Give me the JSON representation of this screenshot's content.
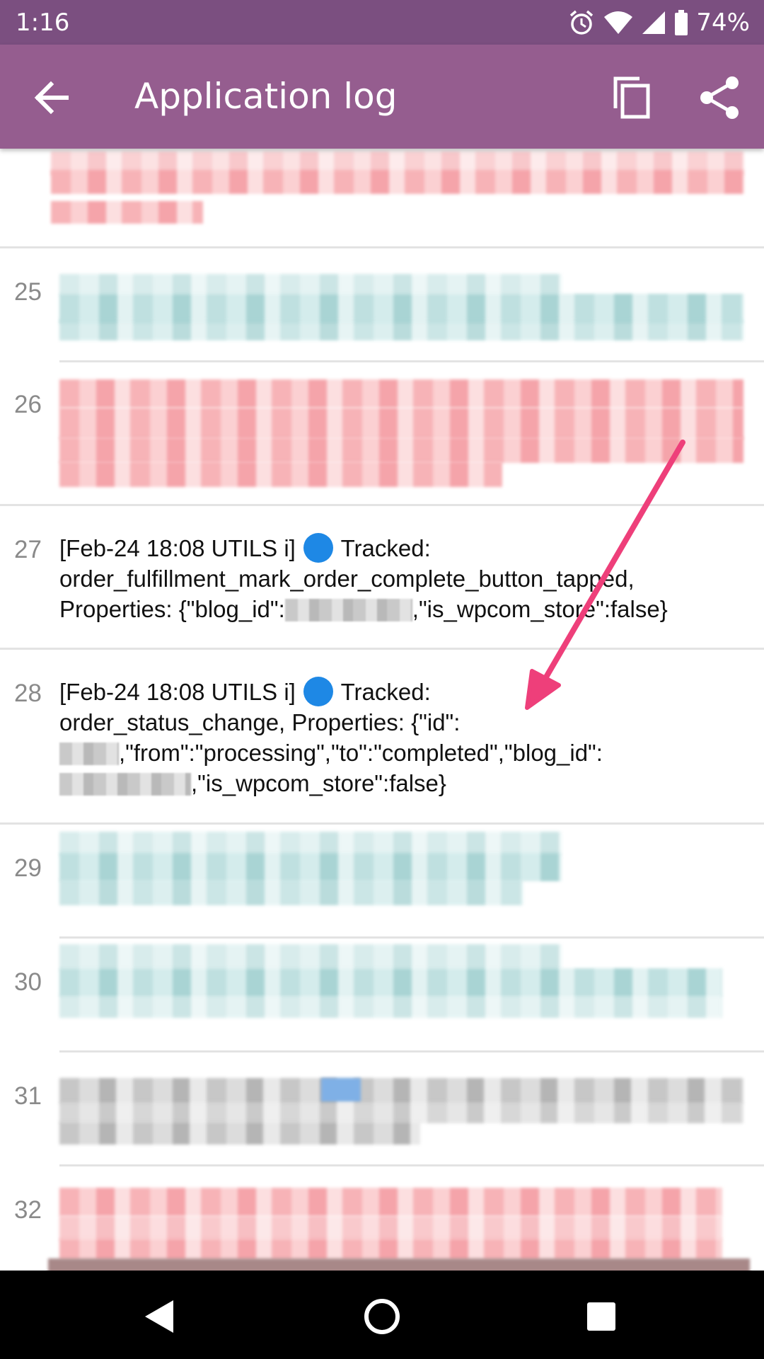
{
  "status_bar": {
    "time": "1:16",
    "battery": "74%",
    "icons": [
      "alarm-icon",
      "wifi-icon",
      "signal-icon",
      "battery-icon"
    ]
  },
  "app_bar": {
    "title": "Application log",
    "icons": [
      "back-arrow-icon",
      "copy-icon",
      "share-icon"
    ]
  },
  "log": {
    "entries": [
      {
        "line": ""
      },
      {
        "line": "25"
      },
      {
        "line": "26"
      },
      {
        "line": "27",
        "l1_prefix": "[Feb-24 18:08 UTILS i]",
        "l1_suffix": "Tracked:",
        "l2": "order_fulfillment_mark_order_complete_button_tapped,",
        "l3_prefix": "Properties: {\"blog_id\":",
        "l3_suffix": ",\"is_wpcom_store\":false}"
      },
      {
        "line": "28",
        "l1_prefix": "[Feb-24 18:08 UTILS i]",
        "l1_suffix": "Tracked:",
        "l2": "order_status_change, Properties: {\"id\":",
        "l3": ",\"from\":\"processing\",\"to\":\"completed\",\"blog_id\":",
        "l4": ",\"is_wpcom_store\":false}"
      },
      {
        "line": "29"
      },
      {
        "line": "30"
      },
      {
        "line": "31"
      },
      {
        "line": "32"
      }
    ]
  },
  "annotation": {
    "arrow_color": "#ee3f7a"
  },
  "colors": {
    "status_bar": "#7b4f80",
    "app_bar": "#955d8f",
    "tracked_dot": "#1e88e5",
    "nav_bar": "#000000"
  },
  "nav_bar": {
    "icons": [
      "back-triangle-icon",
      "home-circle-icon",
      "recents-square-icon"
    ]
  }
}
